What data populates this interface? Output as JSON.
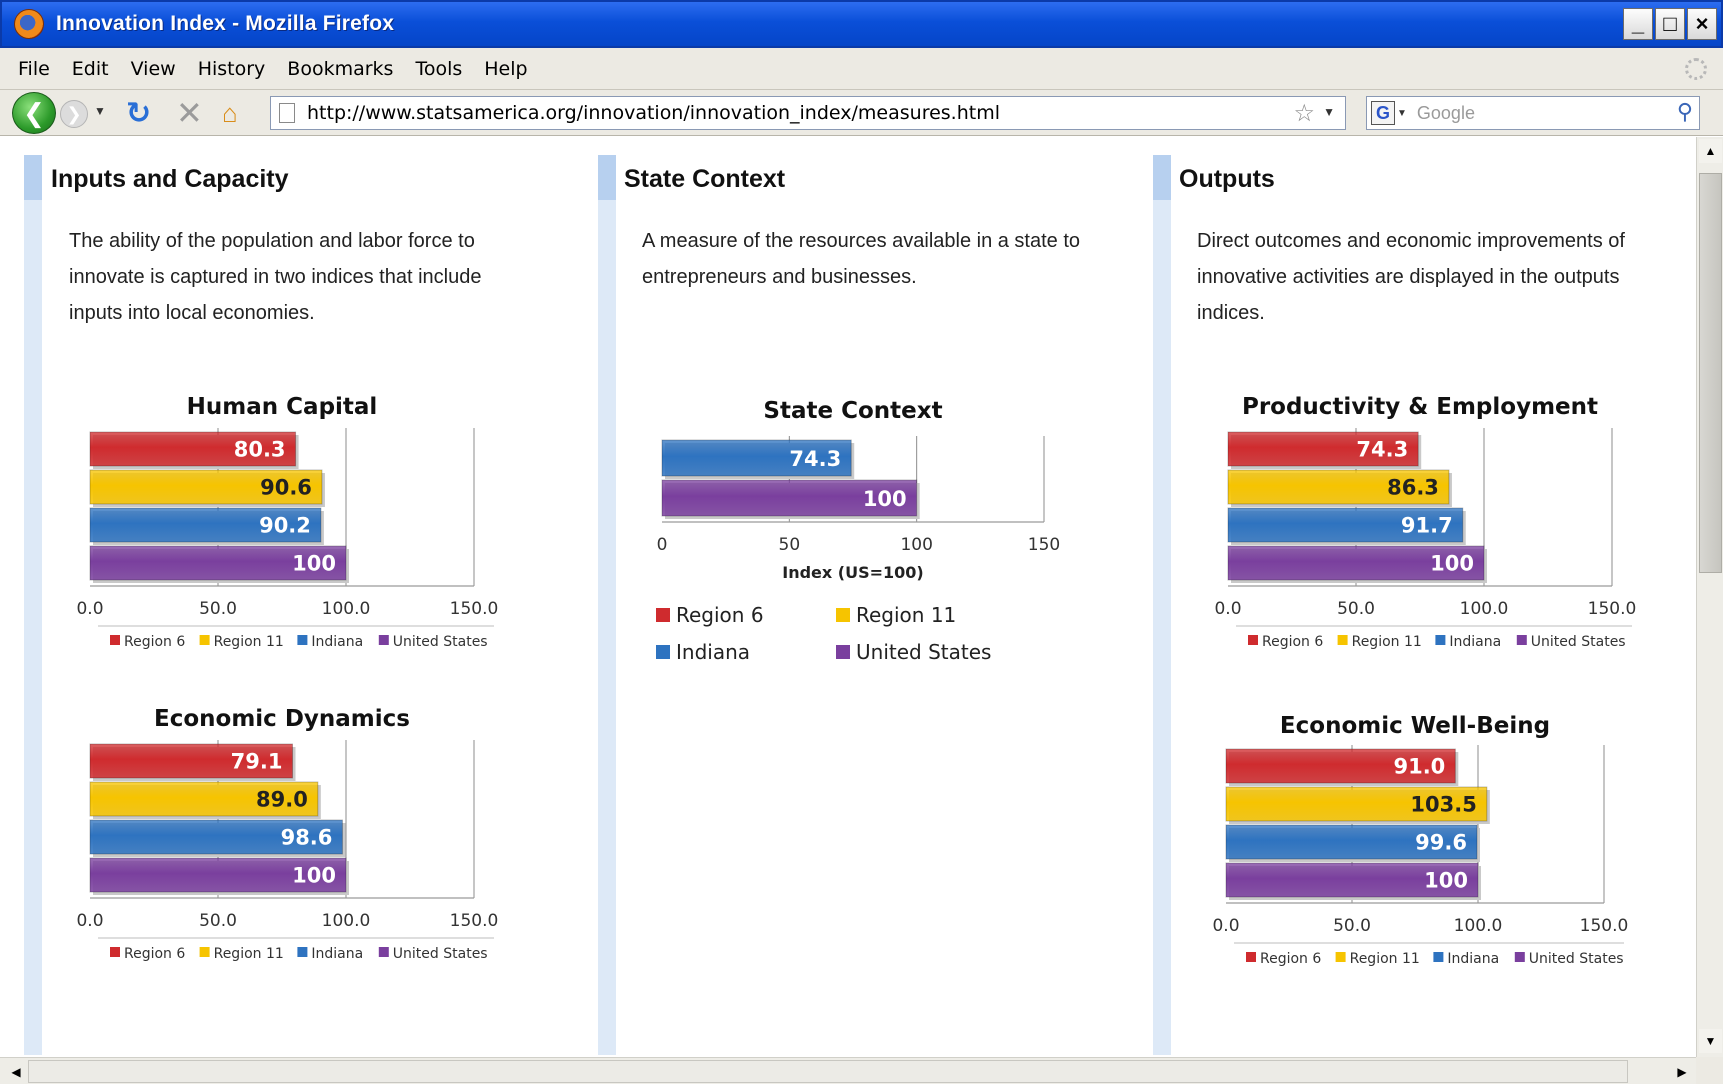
{
  "window": {
    "title": "Innovation Index - Mozilla Firefox",
    "controls": [
      "_",
      "□",
      "×"
    ]
  },
  "menu": [
    "File",
    "Edit",
    "View",
    "History",
    "Bookmarks",
    "Tools",
    "Help"
  ],
  "nav": {
    "url": "http://www.statsamerica.org/innovation/innovation_index/measures.html",
    "search_placeholder": "Google"
  },
  "columns": [
    {
      "heading": "Inputs and Capacity",
      "description_lines": [
        "The ability of the population and labor force to",
        "innovate is captured in two indices that include",
        "inputs into local economies."
      ]
    },
    {
      "heading": "State Context",
      "description_lines": [
        "A measure of the resources available in a state to",
        "entrepreneurs and businesses."
      ]
    },
    {
      "heading": "Outputs",
      "description_lines": [
        "Direct outcomes and economic improvements of",
        "innovative activities are displayed in the outputs",
        "indices."
      ]
    }
  ],
  "colors": {
    "Region 6": "#cf2b2e",
    "Region 11": "#f6c400",
    "Indiana": "#2e73c0",
    "United States": "#7a3f9e"
  },
  "chart_data": [
    {
      "type": "bar",
      "title": "Human Capital",
      "categories": [
        "Region 6",
        "Region 11",
        "Indiana",
        "United States"
      ],
      "values": [
        80.3,
        90.6,
        90.2,
        100
      ],
      "value_labels": [
        "80.3",
        "90.6",
        "90.2",
        "100"
      ],
      "xlim": [
        0,
        150
      ],
      "ticks": [
        "0.0",
        "50.0",
        "100.0",
        "150.0"
      ],
      "xlabel": "",
      "legend": [
        "Region 6",
        "Region 11",
        "Indiana",
        "United States"
      ],
      "legend_position": "bottom",
      "grid": "vertical"
    },
    {
      "type": "bar",
      "title": "Economic Dynamics",
      "categories": [
        "Region 6",
        "Region 11",
        "Indiana",
        "United States"
      ],
      "values": [
        79.1,
        89.0,
        98.6,
        100
      ],
      "value_labels": [
        "79.1",
        "89.0",
        "98.6",
        "100"
      ],
      "xlim": [
        0,
        150
      ],
      "ticks": [
        "0.0",
        "50.0",
        "100.0",
        "150.0"
      ],
      "xlabel": "",
      "legend": [
        "Region 6",
        "Region 11",
        "Indiana",
        "United States"
      ],
      "legend_position": "bottom",
      "grid": "vertical"
    },
    {
      "type": "bar",
      "title": "State Context",
      "categories": [
        "Indiana",
        "United States"
      ],
      "values": [
        74.3,
        100
      ],
      "value_labels": [
        "74.3",
        "100"
      ],
      "xlim": [
        0,
        150
      ],
      "ticks": [
        "0",
        "50",
        "100",
        "150"
      ],
      "xlabel": "Index (US=100)",
      "legend": [
        "Region 6",
        "Region 11",
        "Indiana",
        "United States"
      ],
      "legend_position": "bottom",
      "grid": "vertical"
    },
    {
      "type": "bar",
      "title": "Productivity & Employment",
      "categories": [
        "Region 6",
        "Region 11",
        "Indiana",
        "United States"
      ],
      "values": [
        74.3,
        86.3,
        91.7,
        100
      ],
      "value_labels": [
        "74.3",
        "86.3",
        "91.7",
        "100"
      ],
      "xlim": [
        0,
        150
      ],
      "ticks": [
        "0.0",
        "50.0",
        "100.0",
        "150.0"
      ],
      "xlabel": "",
      "legend": [
        "Region 6",
        "Region 11",
        "Indiana",
        "United States"
      ],
      "legend_position": "bottom",
      "grid": "vertical"
    },
    {
      "type": "bar",
      "title": "Economic Well-Being",
      "categories": [
        "Region 6",
        "Region 11",
        "Indiana",
        "United States"
      ],
      "values": [
        91.0,
        103.5,
        99.6,
        100
      ],
      "value_labels": [
        "91.0",
        "103.5",
        "99.6",
        "100"
      ],
      "xlim": [
        0,
        150
      ],
      "ticks": [
        "0.0",
        "50.0",
        "100.0",
        "150.0"
      ],
      "xlabel": "",
      "legend": [
        "Region 6",
        "Region 11",
        "Indiana",
        "United States"
      ],
      "legend_position": "bottom",
      "grid": "vertical"
    }
  ]
}
